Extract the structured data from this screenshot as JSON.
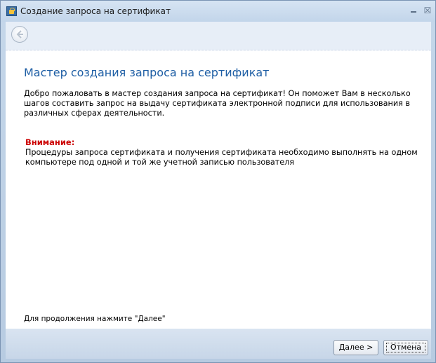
{
  "window": {
    "title": "Создание запроса на сертификат",
    "minimize_glyph": "",
    "close_glyph": "☒"
  },
  "nav": {
    "back_icon": "back-arrow-icon"
  },
  "content": {
    "heading": "Мастер создания запроса на сертификат",
    "intro": "Добро пожаловать в мастер создания запроса на сертификат! Он поможет Вам в несколько шагов составить запрос на выдачу сертификата электронной подписи для использования в различных сферах деятельности.",
    "warning_title": "Внимание:",
    "warning_text": "Процедуры запроса сертификата и получения сертификата необходимо выполнять на одном компьютере под одной и той же учетной записью пользователя",
    "hint": "Для продолжения нажмите \"Далее\""
  },
  "footer": {
    "next_label": "Далее >",
    "cancel_label": "Отмена"
  },
  "colors": {
    "heading": "#1f5fa5",
    "warning": "#cc0000"
  }
}
